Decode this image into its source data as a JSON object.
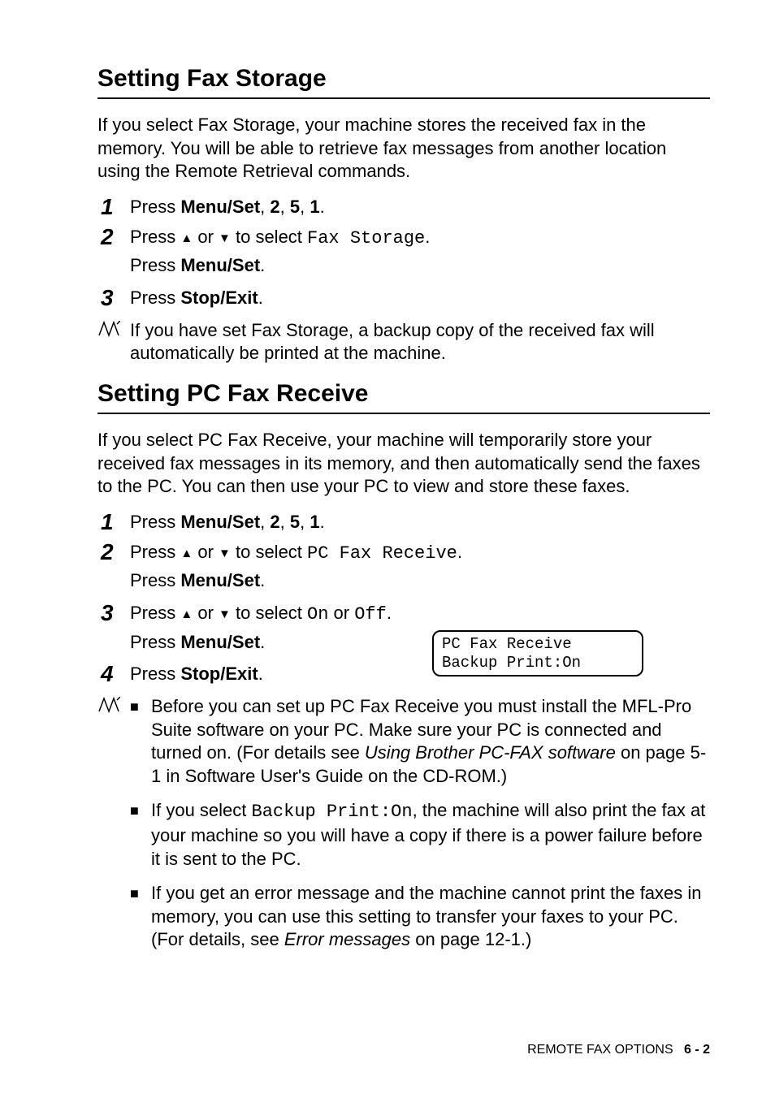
{
  "section1": {
    "heading": "Setting Fax Storage",
    "intro": "If you select Fax Storage, your machine stores the received fax in the memory. You will be able to retrieve fax messages from another location using the Remote Retrieval commands.",
    "steps": [
      {
        "num": "1",
        "pre": "Press ",
        "bold1": "Menu/Set",
        "mid": ", ",
        "bold2": "2",
        "mid2": ", ",
        "bold3": "5",
        "mid3": ", ",
        "bold4": "1",
        "end": "."
      },
      {
        "num": "2",
        "line1_pre": "Press ",
        "line1_mid": " or ",
        "line1_post": " to select ",
        "line1_mono": "Fax Storage",
        "line1_end": ".",
        "line2_pre": "Press ",
        "line2_bold": "Menu/Set",
        "line2_end": "."
      },
      {
        "num": "3",
        "pre": "Press ",
        "bold1": "Stop/Exit",
        "end": "."
      }
    ],
    "note": "If you have set Fax Storage, a backup copy of the received fax will automatically be printed at the machine."
  },
  "section2": {
    "heading": "Setting PC Fax Receive",
    "intro": "If you select PC Fax Receive, your machine will temporarily store your received fax messages in its memory, and then automatically send the faxes to the PC. You can then use your PC to view and store these faxes.",
    "steps": [
      {
        "num": "1",
        "pre": "Press ",
        "bold1": "Menu/Set",
        "mid": ", ",
        "bold2": "2",
        "mid2": ", ",
        "bold3": "5",
        "mid3": ", ",
        "bold4": "1",
        "end": "."
      },
      {
        "num": "2",
        "line1_pre": "Press ",
        "line1_mid": " or ",
        "line1_post": " to select ",
        "line1_mono": "PC Fax Receive",
        "line1_end": ".",
        "line2_pre": "Press ",
        "line2_bold": "Menu/Set",
        "line2_end": "."
      },
      {
        "num": "3",
        "line1_pre": "Press ",
        "line1_mid": " or ",
        "line1_post": " to select ",
        "line1_mono1": "On",
        "line1_or": " or ",
        "line1_mono2": "Off",
        "line1_end": ".",
        "line2_pre": "Press ",
        "line2_bold": "Menu/Set",
        "line2_end": "."
      },
      {
        "num": "4",
        "pre": "Press ",
        "bold1": "Stop/Exit",
        "end": "."
      }
    ],
    "display": {
      "line1": "PC Fax Receive",
      "line2": "Backup Print:On"
    },
    "bullets": [
      {
        "pre": "Before you can set up PC Fax Receive you must install the MFL-Pro Suite software on your PC. Make sure your PC is connected and turned on. (For details see ",
        "italic": "Using Brother PC-FAX software",
        "post": " on page 5-1 in Software User's Guide on the CD-ROM.)"
      },
      {
        "pre": "If you select ",
        "mono": "Backup Print:On",
        "post": ", the machine will also print the fax at your machine so you will have a copy if there is a power failure before it is sent to the PC."
      },
      {
        "pre": "If you get an error message and the machine cannot print the faxes in memory, you can use this setting to transfer your faxes to your PC. (For details, see ",
        "italic": "Error messages",
        "post": " on page 12-1.)"
      }
    ]
  },
  "footer": {
    "text": "REMOTE FAX OPTIONS",
    "page": "6 - 2"
  },
  "glyphs": {
    "up": "▲",
    "down": "▼",
    "square": "■"
  }
}
